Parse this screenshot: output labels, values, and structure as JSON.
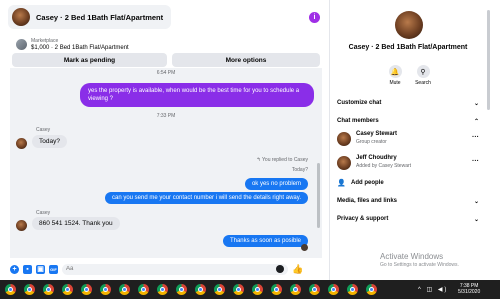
{
  "header": {
    "title": "Casey · 2 Bed 1Bath Flat/Apartment",
    "info_icon": "info-icon",
    "accent": "#9f2ee6"
  },
  "listing": {
    "source": "Marketplace",
    "detail": "$1,000 · 2 Bed 1Bath Flat/Apartment",
    "mark_pending_label": "Mark as pending",
    "more_options_label": "More options"
  },
  "messages": {
    "timestamp_1": "6:54 PM",
    "out_1": "yes the property is available, when would be the best time for you to schedule a viewing ?",
    "timestamp_2": "7:33 PM",
    "sender_1": "Casey",
    "in_1": "Today?",
    "replied_note": "↰ You replied to Casey",
    "quoted": "Today?",
    "out_2": "ok yes no problem",
    "out_3": "can you send me your contact number i will send the details right away.",
    "sender_2": "Casey",
    "in_2": "860 541 1524. Thank you",
    "out_4": "Thanks as soon as posible"
  },
  "composer": {
    "placeholder": "Aa",
    "icons": [
      "plus-icon",
      "sticker-icon",
      "gallery-icon",
      "gif-icon",
      "emoji-icon",
      "thumbs-up-icon"
    ],
    "brand_color": "#1877f2"
  },
  "info": {
    "name": "Casey · 2 Bed 1Bath Flat/Apartment",
    "mute_label": "Mute",
    "search_label": "Search",
    "customize_chat": "Customize chat",
    "chat_members": "Chat members",
    "members": [
      {
        "name": "Casey Stewart",
        "role": "Group creator"
      },
      {
        "name": "Jeff Choudhry",
        "role": "Added by Casey Stewart"
      }
    ],
    "add_people": "Add people",
    "media_files_links": "Media, files and links",
    "privacy_support": "Privacy & support"
  },
  "watermark": {
    "title": "Activate Windows",
    "subtitle": "Go to Settings to activate Windows."
  },
  "taskbar": {
    "clock_time": "7:38 PM",
    "clock_date": "5/31/2020",
    "app_icons": "chrome-icon"
  }
}
